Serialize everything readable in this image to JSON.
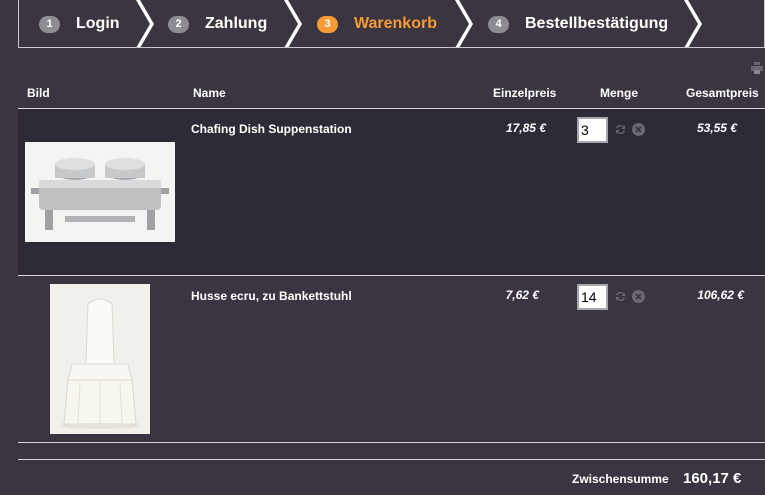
{
  "steps": [
    {
      "number": "1",
      "label": "Login"
    },
    {
      "number": "2",
      "label": "Zahlung"
    },
    {
      "number": "3",
      "label": "Warenkorb"
    },
    {
      "number": "4",
      "label": "Bestellbestätigung"
    }
  ],
  "active_step": 3,
  "table": {
    "columns": {
      "image": "Bild",
      "name": "Name",
      "unit_price": "Einzelpreis",
      "quantity": "Menge",
      "total_price": "Gesamtpreis"
    },
    "rows": [
      {
        "name": "Chafing Dish Suppenstation",
        "unit_price": "17,85 €",
        "quantity": "3",
        "total_price": "53,55 €",
        "image_icon": "chafing-dish-image"
      },
      {
        "name": "Husse ecru, zu Bankettstuhl",
        "unit_price": "7,62 €",
        "quantity": "14",
        "total_price": "106,62 €",
        "image_icon": "chair-cover-image"
      }
    ]
  },
  "summary": {
    "subtotal_label": "Zwischensumme",
    "subtotal_value": "160,17 €"
  },
  "colors": {
    "background": "#3a3541",
    "row_background": "#2f2b36",
    "active_accent": "#f59a35",
    "inactive_badge": "#8e8b93"
  },
  "icons": {
    "print": "print-icon",
    "refresh": "refresh-icon",
    "remove": "remove-icon"
  }
}
